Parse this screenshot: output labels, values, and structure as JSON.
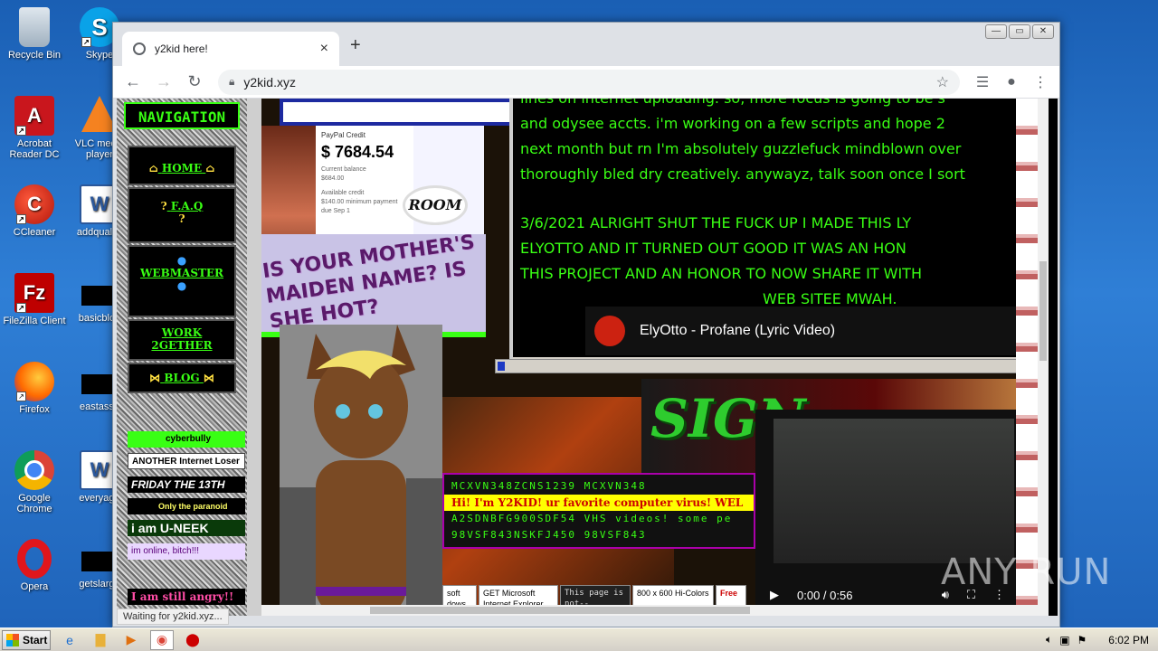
{
  "desktop": {
    "icons": [
      {
        "label": "Recycle Bin"
      },
      {
        "label": "Skype"
      },
      {
        "label": "Acrobat Reader DC"
      },
      {
        "label": "VLC media player"
      },
      {
        "label": "CCleaner"
      },
      {
        "label": "addquality"
      },
      {
        "label": "FileZilla Client"
      },
      {
        "label": "basicblog"
      },
      {
        "label": "Firefox"
      },
      {
        "label": "eastasso"
      },
      {
        "label": "Google Chrome"
      },
      {
        "label": "everyaga"
      },
      {
        "label": "Opera"
      },
      {
        "label": "getslarge"
      }
    ]
  },
  "browser": {
    "tab_title": "y2kid here!",
    "url": "y2kid.xyz",
    "status_text": "Waiting for y2kid.xyz..."
  },
  "page": {
    "nav_header": "NAVIGATION",
    "nav_items": [
      {
        "label": "HOME"
      },
      {
        "label": "F.A.Q"
      },
      {
        "label": "WEBMASTER"
      },
      {
        "label": "WORK 2GETHER"
      },
      {
        "label": "BLOG"
      }
    ],
    "side_badges": [
      {
        "text": "cyberbully",
        "bg": "#39ff14",
        "fg": "#000000"
      },
      {
        "text": "ANOTHER Internet Loser",
        "bg": "#ffffff",
        "fg": "#000000"
      },
      {
        "text": "FRIDAY THE 13TH",
        "bg": "#000000",
        "fg": "#ffffff"
      },
      {
        "text": "Only the paranoid survive",
        "bg": "#000000",
        "fg": "#ffff66"
      },
      {
        "text": "i am U-NEEK",
        "bg": "#0a3a0a",
        "fg": "#ffffff"
      },
      {
        "text": "im online, bitch!!!",
        "bg": "#e9d7ff",
        "fg": "#5a007a"
      },
      {
        "text": "I am still angry!!",
        "bg": "#000000",
        "fg": "#ff4da6"
      }
    ],
    "paypal": {
      "label": "PayPal Credit",
      "amount": "$ 7684.54",
      "current_balance_label": "Current balance",
      "current_balance": "$684.00",
      "available_label": "Available credit",
      "min_payment": "$140.00 minimum payment due Sep 1"
    },
    "room_sticker": "ROOM",
    "collage_text": "IS YOUR MOTHER'S MAIDEN NAME? IS SHE HOT?",
    "blog_lines": [
      "lines on internet uploading. so, more focus is going to be s",
      "and odysee accts. i'm working on a few scripts and hope 2",
      "next month but rn I'm absolutely guzzlefuck mindblown over",
      "thoroughly bled dry creatively. anywayz, talk soon once I sort"
    ],
    "blog_caps_lines": [
      "3/6/2021 ALRIGHT SHUT THE FUCK UP I MADE THIS LY",
      "ELYOTTO AND IT TURNED OUT GOOD IT WAS AN HON",
      "THIS PROJECT AND AN HONOR TO NOW SHARE IT WITH",
      "WEB SITEE MWAH."
    ],
    "video1_title": "ElyOtto - Profane (Lyric Video)",
    "sign_text": "SIGN",
    "ticker": {
      "row1": "MCXVN348ZCNS1239 MCXVN348",
      "row2": "Hi! I'm Y2KID! ur favorite computer virus! WEL",
      "row3": "A2SDNBFG900SDF54 VHS videos! some pe",
      "row4": "98VSF843NSKFJ450 98VSF843"
    },
    "badges": [
      {
        "text": "soft dows"
      },
      {
        "text": "GET Microsoft Internet Explorer"
      },
      {
        "text": "This page is not--"
      },
      {
        "text": "800 x 600 Hi-Colors"
      },
      {
        "text": "Free"
      }
    ],
    "video2": {
      "time": "0:00 / 0:56",
      "progress": 0.3
    }
  },
  "taskbar": {
    "start_label": "Start",
    "clock": "6:02 PM"
  },
  "watermark": "ANY RUN"
}
